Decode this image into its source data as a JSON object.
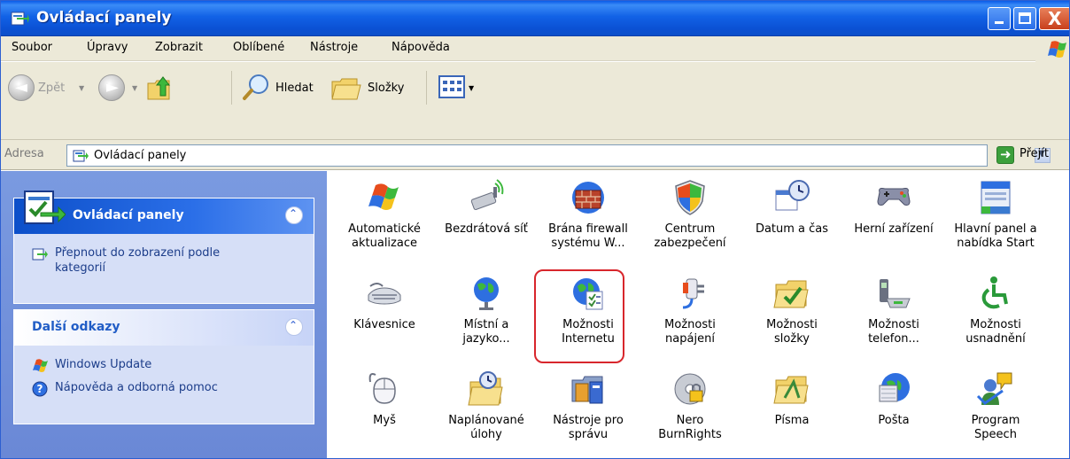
{
  "window": {
    "title": "Ovládací panely",
    "close_glyph": "X"
  },
  "menu": [
    "Soubor",
    "Úpravy",
    "Zobrazit",
    "Oblíbené",
    "Nástroje",
    "Nápověda"
  ],
  "toolbar": {
    "back_label": "Zpět",
    "search_label": "Hledat",
    "folders_label": "Složky"
  },
  "address": {
    "label": "Adresa",
    "value": "Ovládací panely",
    "go_label": "Přejít"
  },
  "left_pane": {
    "control_panel": {
      "title": "Ovládací panely",
      "switch_view_line1": "Přepnout do zobrazení podle",
      "switch_view_line2": "kategorií"
    },
    "other_links": {
      "title": "Další odkazy",
      "windows_update": "Windows Update",
      "help": "Nápověda a odborná pomoc"
    }
  },
  "items": [
    {
      "l1": "Automatické",
      "l2": "aktualizace",
      "icon": "windows-flag-icon"
    },
    {
      "l1": "Bezdrátová síť",
      "l2": "",
      "icon": "wireless-network-icon"
    },
    {
      "l1": "Brána firewall",
      "l2": "systému W...",
      "icon": "firewall-icon"
    },
    {
      "l1": "Centrum",
      "l2": "zabezpečení",
      "icon": "security-shield-icon"
    },
    {
      "l1": "Datum a čas",
      "l2": "",
      "icon": "date-time-icon"
    },
    {
      "l1": "Herní zařízení",
      "l2": "",
      "icon": "game-controller-icon"
    },
    {
      "l1": "Hlavní panel a",
      "l2": "nabídka Start",
      "icon": "taskbar-icon"
    },
    {
      "l1": "Klávesnice",
      "l2": "",
      "icon": "keyboard-icon"
    },
    {
      "l1": "Místní a",
      "l2": "jazyko...",
      "icon": "globe-icon"
    },
    {
      "l1": "Možnosti",
      "l2": "Internetu",
      "icon": "internet-options-icon"
    },
    {
      "l1": "Možnosti",
      "l2": "napájení",
      "icon": "power-options-icon"
    },
    {
      "l1": "Možnosti",
      "l2": "složky",
      "icon": "folder-options-icon"
    },
    {
      "l1": "Možnosti",
      "l2": "telefon...",
      "icon": "phone-modem-icon"
    },
    {
      "l1": "Možnosti",
      "l2": "usnadnění",
      "icon": "accessibility-icon"
    },
    {
      "l1": "Myš",
      "l2": "",
      "icon": "mouse-icon"
    },
    {
      "l1": "Naplánované",
      "l2": "úlohy",
      "icon": "scheduled-tasks-icon"
    },
    {
      "l1": "Nástroje pro",
      "l2": "správu",
      "icon": "admin-tools-icon"
    },
    {
      "l1": "Nero",
      "l2": "BurnRights",
      "icon": "nero-disc-icon"
    },
    {
      "l1": "Písma",
      "l2": "",
      "icon": "fonts-folder-icon"
    },
    {
      "l1": "Pošta",
      "l2": "",
      "icon": "mail-icon"
    },
    {
      "l1": "Program",
      "l2": "Speech",
      "icon": "speech-icon"
    }
  ],
  "highlighted_item": "Možnosti Internetu",
  "colors": {
    "titlebar": "#0b51d4",
    "left_pane": "#6a88d6",
    "highlight": "#d8262c"
  }
}
